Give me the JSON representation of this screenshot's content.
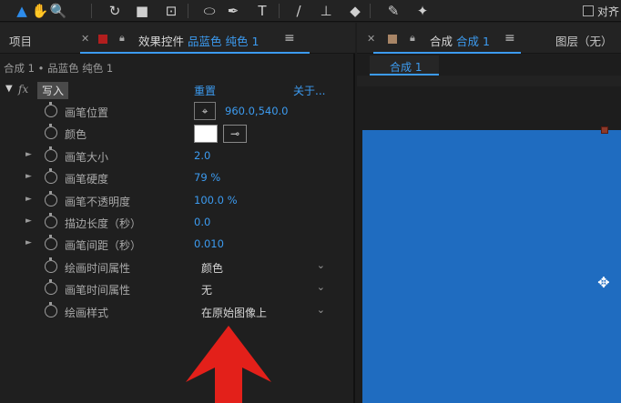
{
  "toolbar": {
    "tools": [
      {
        "icon": "selection-arrow-icon",
        "glyph": "▲",
        "active": true
      },
      {
        "icon": "hand-icon",
        "glyph": "✋"
      },
      {
        "icon": "zoom-icon",
        "glyph": "🔍"
      },
      {
        "icon": "rotate-icon",
        "glyph": "↻"
      },
      {
        "icon": "camera-icon",
        "glyph": "■"
      },
      {
        "icon": "pan-behind-icon",
        "glyph": "⊡"
      },
      {
        "icon": "ellipse-icon",
        "glyph": "⬭"
      },
      {
        "icon": "pen-icon",
        "glyph": "✒"
      },
      {
        "icon": "type-icon",
        "glyph": "T"
      },
      {
        "icon": "brush-icon",
        "glyph": "/"
      },
      {
        "icon": "clone-stamp-icon",
        "glyph": "⊥"
      },
      {
        "icon": "eraser-icon",
        "glyph": "◆"
      },
      {
        "icon": "roto-brush-icon",
        "glyph": "✎"
      },
      {
        "icon": "puppet-pin-icon",
        "glyph": "✦"
      }
    ],
    "align_label": "对齐"
  },
  "left_panel": {
    "project_tab": "项目",
    "effects_tab": {
      "prefix": "效果控件",
      "layer_name": "品蓝色 纯色 1",
      "chip_color": "#b21e1e"
    },
    "breadcrumb": "合成 1 • 品蓝色 纯色 1",
    "effect": {
      "fx": "fx",
      "name": "写入",
      "reset": "重置",
      "about": "关于..."
    },
    "properties": [
      {
        "label": "画笔位置",
        "type": "point",
        "value": "960.0,540.0",
        "expandable": false
      },
      {
        "label": "颜色",
        "type": "color",
        "value": "#ffffff",
        "expandable": false
      },
      {
        "label": "画笔大小",
        "type": "number",
        "value": "2.0",
        "expandable": true
      },
      {
        "label": "画笔硬度",
        "type": "number",
        "value": "79 %",
        "expandable": true
      },
      {
        "label": "画笔不透明度",
        "type": "number",
        "value": "100.0 %",
        "expandable": true
      },
      {
        "label": "描边长度（秒）",
        "type": "number",
        "value": "0.0",
        "expandable": true
      },
      {
        "label": "画笔间距（秒）",
        "type": "number",
        "value": "0.010",
        "expandable": true
      },
      {
        "label": "绘画时间属性",
        "type": "dropdown",
        "value": "颜色",
        "expandable": false
      },
      {
        "label": "画笔时间属性",
        "type": "dropdown",
        "value": "无",
        "expandable": false
      },
      {
        "label": "绘画样式",
        "type": "dropdown",
        "value": "在原始图像上",
        "expandable": false
      }
    ]
  },
  "right_panel": {
    "comp_tab": {
      "prefix": "合成",
      "name": "合成 1",
      "chip_color": "#a88566"
    },
    "layer_tab": "图层（无）",
    "subtab": "合成 1",
    "canvas_color": "#1f6cc0"
  },
  "overlay": {
    "arrow_color": "#e3201a"
  }
}
